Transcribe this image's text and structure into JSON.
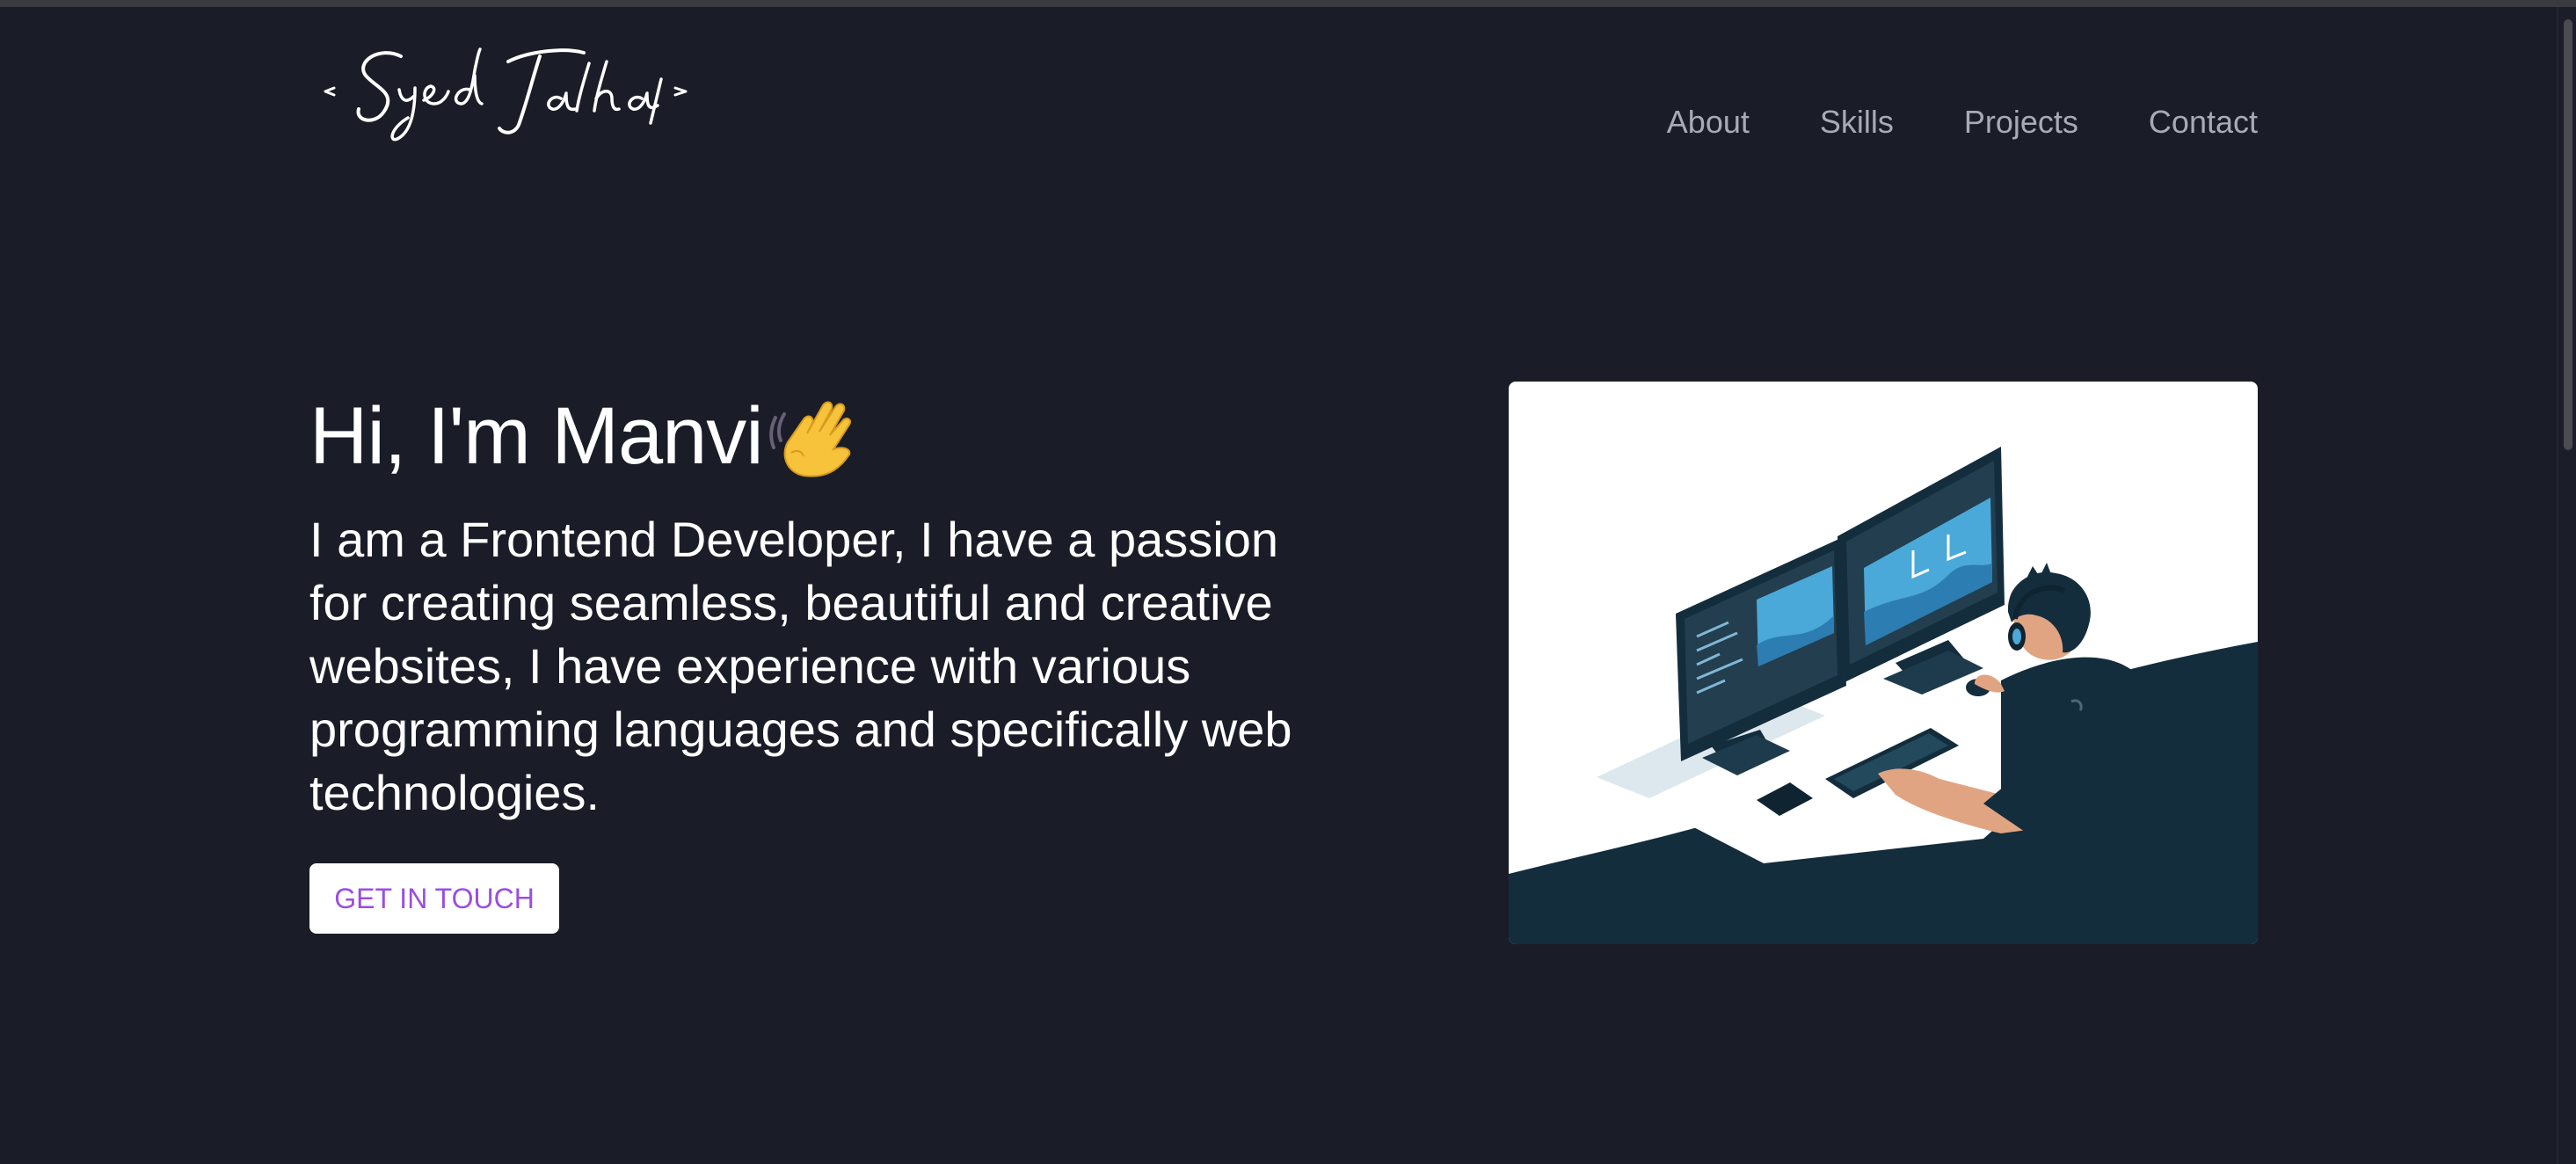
{
  "logo": {
    "text": "< Syed Talha / >"
  },
  "nav": {
    "items": [
      {
        "label": "About"
      },
      {
        "label": "Skills"
      },
      {
        "label": "Projects"
      },
      {
        "label": "Contact"
      }
    ]
  },
  "hero": {
    "title": "Hi, I'm Manvi",
    "emoji_icon": "waving-hand-icon",
    "description": "I am a Frontend Developer, I have a passion for creating seamless, beautiful and creative websites, I have experience with various programming languages and specifically web technologies.",
    "cta_label": "GET IN TOUCH"
  },
  "colors": {
    "background": "#1a1d27",
    "nav_text": "#a6abb6",
    "cta_text": "#9b4de3",
    "illustration_dark": "#132d3c",
    "illustration_accent": "#4aa9d8"
  }
}
